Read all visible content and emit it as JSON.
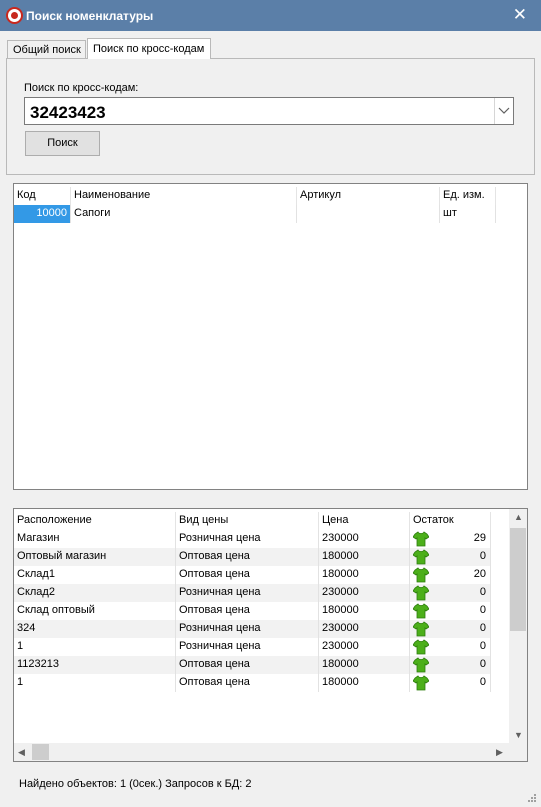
{
  "window": {
    "title": "Поиск номенклатуры",
    "close_glyph": "✕"
  },
  "tabs": [
    {
      "label": "Общий поиск",
      "active": false
    },
    {
      "label": "Поиск по кросс-кодам",
      "active": true
    }
  ],
  "search": {
    "label": "Поиск по кросс-кодам:",
    "value": "32423423",
    "button_label": "Поиск"
  },
  "items_table": {
    "columns": [
      "Код",
      "Наименование",
      "Артикул",
      "Ед. изм."
    ],
    "rows": [
      {
        "code": "10000",
        "name": "Сапоги",
        "article": "",
        "unit": "шт",
        "selected": true
      }
    ]
  },
  "stock_table": {
    "columns": [
      "Расположение",
      "Вид цены",
      "Цена",
      "Остаток"
    ],
    "rows": [
      {
        "location": "Магазин",
        "price_type": "Розничная цена",
        "price": "230000",
        "stock": "29"
      },
      {
        "location": "Оптовый магазин",
        "price_type": "Оптовая цена",
        "price": "180000",
        "stock": "0"
      },
      {
        "location": "Склад1",
        "price_type": "Оптовая цена",
        "price": "180000",
        "stock": "20"
      },
      {
        "location": "Склад2",
        "price_type": "Розничная цена",
        "price": "230000",
        "stock": "0"
      },
      {
        "location": "Склад оптовый",
        "price_type": "Оптовая цена",
        "price": "180000",
        "stock": "0"
      },
      {
        "location": "324",
        "price_type": "Розничная цена",
        "price": "230000",
        "stock": "0"
      },
      {
        "location": "1",
        "price_type": "Розничная цена",
        "price": "230000",
        "stock": "0"
      },
      {
        "location": "1123213",
        "price_type": "Оптовая цена",
        "price": "180000",
        "stock": "0"
      },
      {
        "location": "1",
        "price_type": "Оптовая цена",
        "price": "180000",
        "stock": "0"
      }
    ]
  },
  "status": {
    "text": "Найдено объектов: 1 (0сек.) Запросов к БД: 2"
  },
  "colors": {
    "titlebar": "#5b7fa8",
    "selection": "#3399e6",
    "row_alt": "#f2f2f2",
    "stock_icon": "#4caf1a"
  }
}
